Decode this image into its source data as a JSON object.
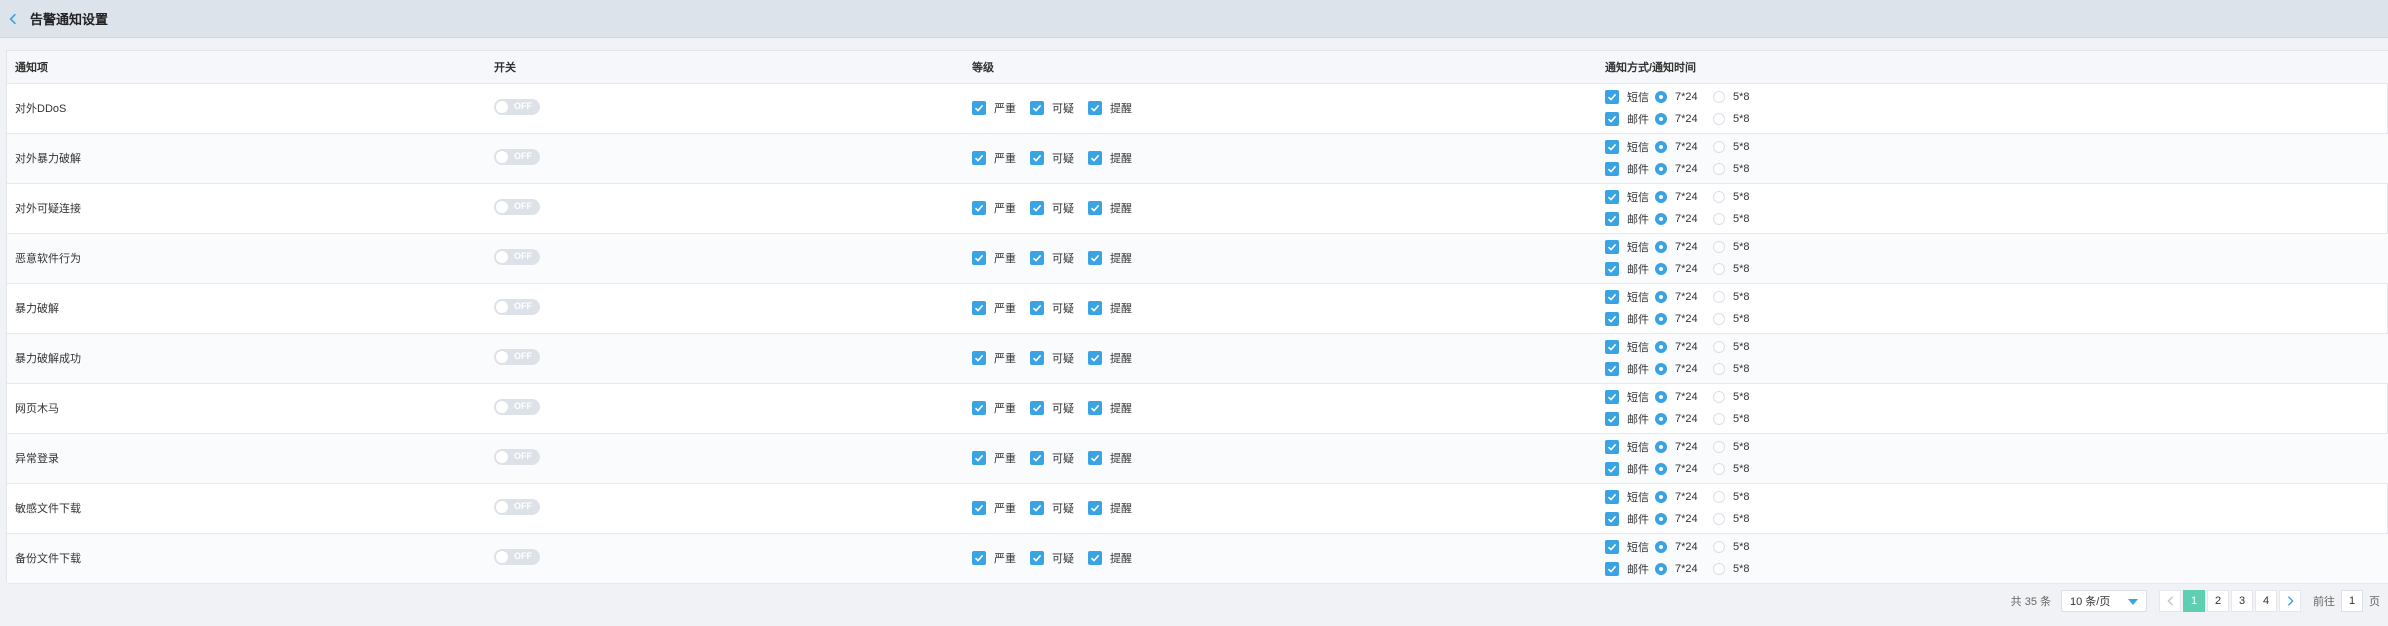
{
  "header": {
    "title": "告警通知设置"
  },
  "columns": {
    "item": "通知项",
    "switch": "开关",
    "level": "等级",
    "notify": "通知方式/通知时间"
  },
  "switch_label": "OFF",
  "levels": [
    "严重",
    "可疑",
    "提醒"
  ],
  "notify": {
    "sms": "短信",
    "email": "邮件",
    "time_a": "7*24",
    "time_b": "5*8"
  },
  "rows": [
    {
      "name": "对外DDoS"
    },
    {
      "name": "对外暴力破解"
    },
    {
      "name": "对外可疑连接"
    },
    {
      "name": "恶意软件行为"
    },
    {
      "name": "暴力破解"
    },
    {
      "name": "暴力破解成功"
    },
    {
      "name": "网页木马"
    },
    {
      "name": "异常登录"
    },
    {
      "name": "敏感文件下载"
    },
    {
      "name": "备份文件下载"
    }
  ],
  "pagination": {
    "total": "共 35 条",
    "page_size": "10 条/页",
    "pages": [
      "1",
      "2",
      "3",
      "4"
    ],
    "current": "1",
    "goto_prefix": "前往",
    "goto_value": "1",
    "goto_suffix": "页"
  },
  "colors": {
    "accent": "#3aa3e3",
    "active_page": "#5fcfb4",
    "header_bg": "#dde3ea"
  }
}
